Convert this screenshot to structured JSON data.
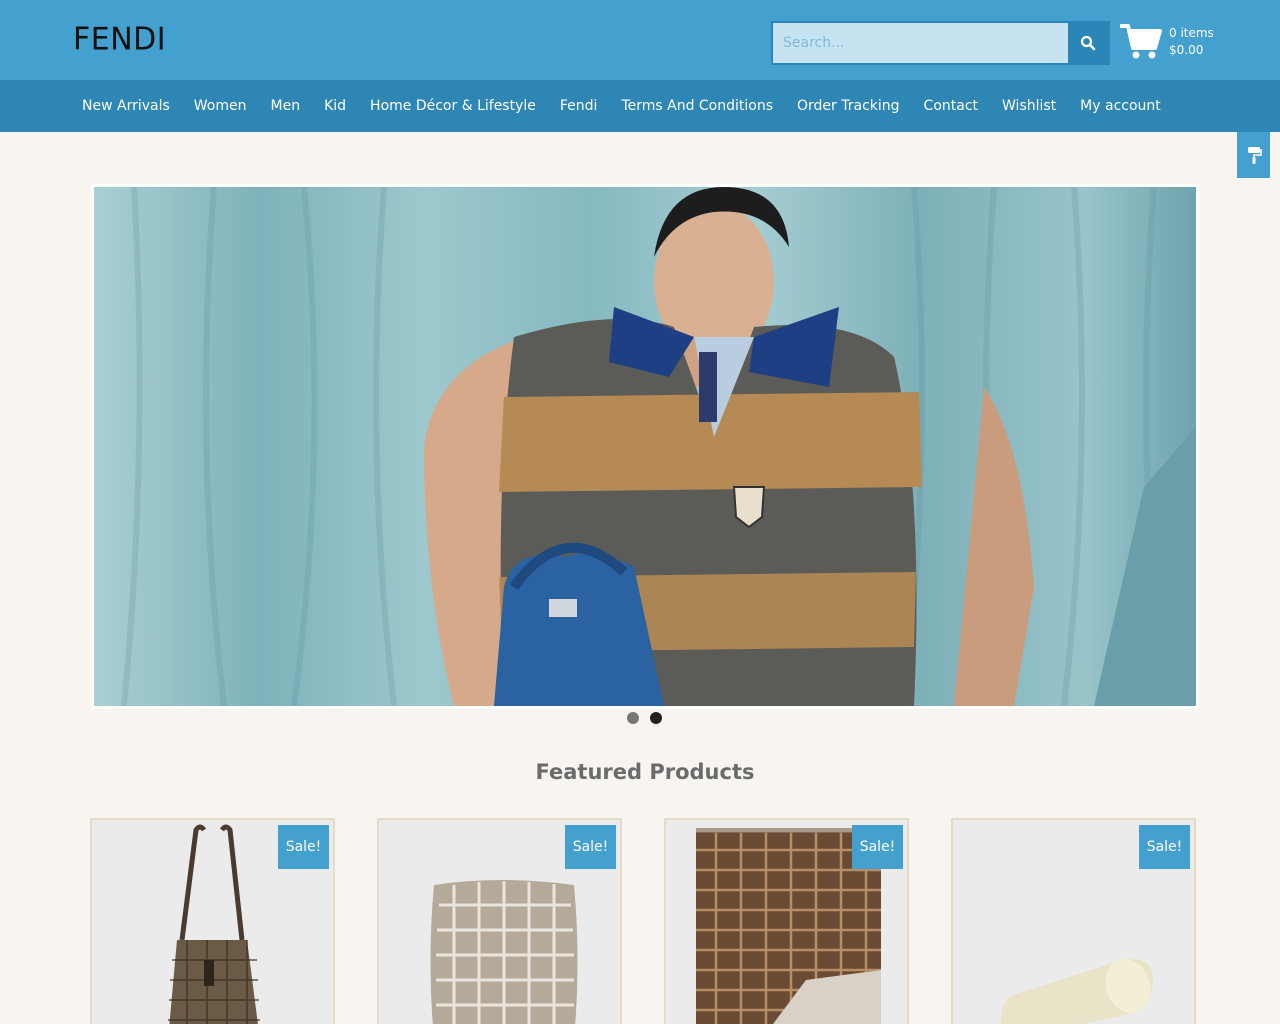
{
  "brand": {
    "logo_text": "FENDI"
  },
  "search": {
    "placeholder": "Search..."
  },
  "cart": {
    "items_label": "0 items",
    "total": "$0.00"
  },
  "nav": {
    "items": [
      "New Arrivals",
      "Women",
      "Men",
      "Kid",
      "Home Décor & Lifestyle",
      "Fendi",
      "Terms And Conditions",
      "Order Tracking",
      "Contact",
      "Wishlist",
      "My account"
    ]
  },
  "slider": {
    "slide_count": 2,
    "active_index": 1
  },
  "featured": {
    "title": "Featured Products",
    "products": [
      {
        "badge": "Sale!"
      },
      {
        "badge": "Sale!"
      },
      {
        "badge": "Sale!"
      },
      {
        "badge": "Sale!"
      }
    ]
  },
  "colors": {
    "header": "#43a0cf",
    "nav": "#2e86b4",
    "background": "#f8f5f0",
    "badge": "#43a0cf"
  }
}
